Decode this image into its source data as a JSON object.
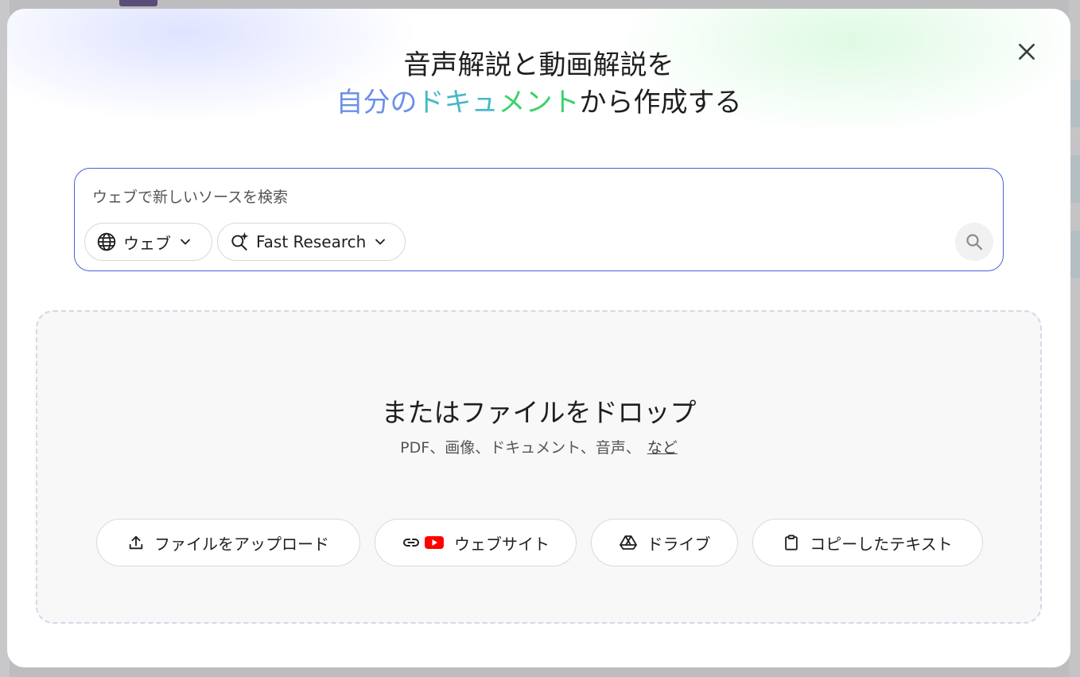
{
  "dialog": {
    "headline_line1": "音声解説と動画解説を",
    "headline_part_a": "自分の",
    "headline_part_b": "ドキュ",
    "headline_part_c": "メント",
    "headline_part_d": "から作成する"
  },
  "search": {
    "placeholder": "ウェブで新しいソースを検索",
    "source_chip_label": "ウェブ",
    "mode_chip_label": "Fast Research"
  },
  "drop": {
    "title": "またはファイルをドロップ",
    "subtitle": "PDF、画像、ドキュメント、音声、",
    "more_link": "など"
  },
  "buttons": {
    "upload": "ファイルをアップロード",
    "website": "ウェブサイト",
    "drive": "ドライブ",
    "copied_text": "コピーしたテキスト"
  },
  "colors": {
    "accent_border": "#4b5fd8",
    "gradient_blue": "#6c8fe8",
    "gradient_teal": "#46b9c6",
    "gradient_green": "#3bd26b",
    "youtube_red": "#ff0000"
  }
}
